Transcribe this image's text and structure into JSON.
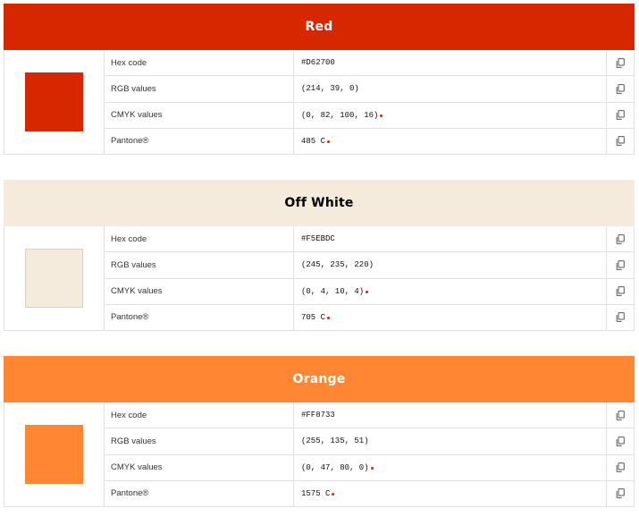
{
  "colors": [
    {
      "name": "Red",
      "header_bg": "#D62700",
      "header_text_color": "#ffffff",
      "swatch": "#D62700",
      "swatch_border": "#D62700",
      "dot_color": "#D62700",
      "rows": [
        {
          "label": "Hex code",
          "value": "#D62700",
          "dot": false
        },
        {
          "label": "RGB values",
          "value": "(214, 39, 0)",
          "dot": false
        },
        {
          "label": "CMYK values",
          "value": "(0, 82, 100, 16)",
          "dot": true
        },
        {
          "label": "Pantone®",
          "value": "485 C",
          "dot": true
        }
      ]
    },
    {
      "name": "Off White",
      "header_bg": "#F5EBDC",
      "header_text_color": "#000000",
      "swatch": "#F5EBDC",
      "swatch_border": "#d8d0c4",
      "dot_color": "#D62700",
      "rows": [
        {
          "label": "Hex code",
          "value": "#F5EBDC",
          "dot": false
        },
        {
          "label": "RGB values",
          "value": "(245, 235, 220)",
          "dot": false
        },
        {
          "label": "CMYK values",
          "value": "(0, 4, 10, 4)",
          "dot": true
        },
        {
          "label": "Pantone®",
          "value": "705 C",
          "dot": true
        }
      ]
    },
    {
      "name": "Orange",
      "header_bg": "#FF8733",
      "header_text_color": "#ffffff",
      "swatch": "#FF8733",
      "swatch_border": "#FF8733",
      "dot_color": "#D62700",
      "rows": [
        {
          "label": "Hex code",
          "value": "#FF8733",
          "dot": false
        },
        {
          "label": "RGB values",
          "value": "(255, 135, 51)",
          "dot": false
        },
        {
          "label": "CMYK values",
          "value": "(0, 47, 80, 0)",
          "dot": true
        },
        {
          "label": "Pantone®",
          "value": "1575 C",
          "dot": true
        }
      ]
    }
  ],
  "icons": {
    "copy": "copy-icon"
  }
}
